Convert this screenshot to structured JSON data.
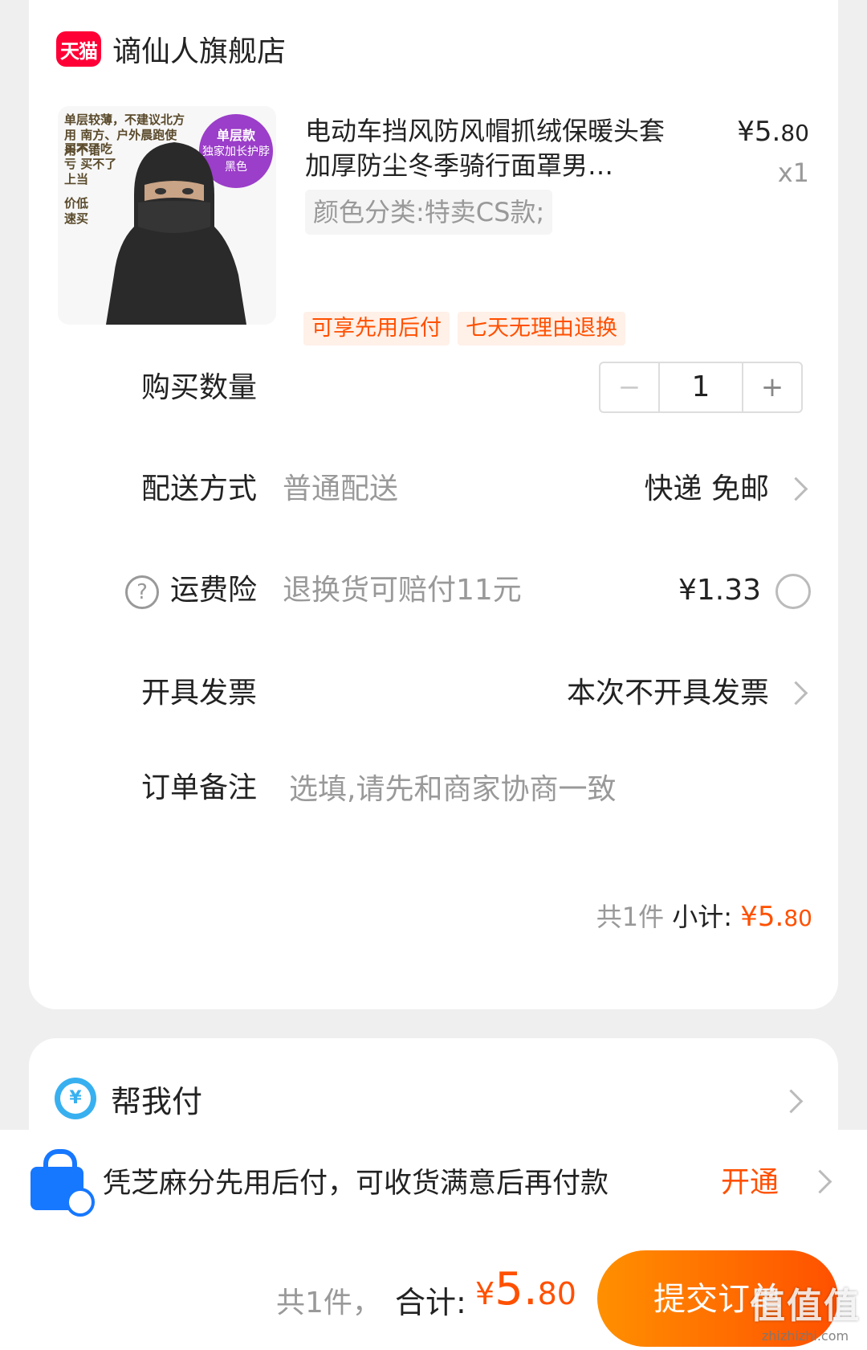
{
  "store": {
    "logo_text": "天猫",
    "name": "谪仙人旗舰店"
  },
  "product": {
    "title": "电动车挡风防风帽抓绒保暖头套加厚防尘冬季骑行面罩男…",
    "spec": "颜色分类:特卖CS款;",
    "price_symbol": "¥",
    "price_int": "5.",
    "price_dec": "80",
    "quantity_label": "x1",
    "tags": [
      "可享先用后付",
      "七天无理由退换"
    ],
    "image": {
      "promo_top": "单层较薄，不建议北方用 南方、户外晨跑使用不错",
      "promo_mid": "买不了吃亏 买不了上当",
      "promo_low": "价低 速买",
      "badge_line1": "单层款",
      "badge_line2": "独家加长护脖",
      "badge_line3": "黑色"
    }
  },
  "quantity_row": {
    "label": "购买数量",
    "minus": "−",
    "value": "1",
    "plus": "+"
  },
  "delivery_row": {
    "label": "配送方式",
    "sub": "普通配送",
    "value": "快递 免邮"
  },
  "insurance_row": {
    "help": "?",
    "label": "运费险",
    "sub": "退换货可赔付11元",
    "price": "¥1.33"
  },
  "invoice_row": {
    "label": "开具发票",
    "value": "本次不开具发票"
  },
  "note_row": {
    "label": "订单备注",
    "placeholder": "选填,请先和商家协商一致"
  },
  "subtotal": {
    "count": "共1件",
    "label": "小计:",
    "symbol": "¥",
    "int": "5.",
    "dec": "80"
  },
  "helper": {
    "icon_text": "¥",
    "label": "帮我付"
  },
  "credit": {
    "text": "凭芝麻分先用后付，可收货满意后再付款",
    "action": "开通"
  },
  "bottom": {
    "count": "共1件，",
    "label": "合计:",
    "symbol": "¥",
    "int": "5.",
    "dec": "80",
    "submit": "提交订单"
  },
  "watermark": {
    "main": "值值值",
    "sub": "zhizhizhi.com"
  },
  "colors": {
    "accent": "#ff5000",
    "tmall": "#ff0036",
    "alipay_blue": "#1677ff"
  }
}
